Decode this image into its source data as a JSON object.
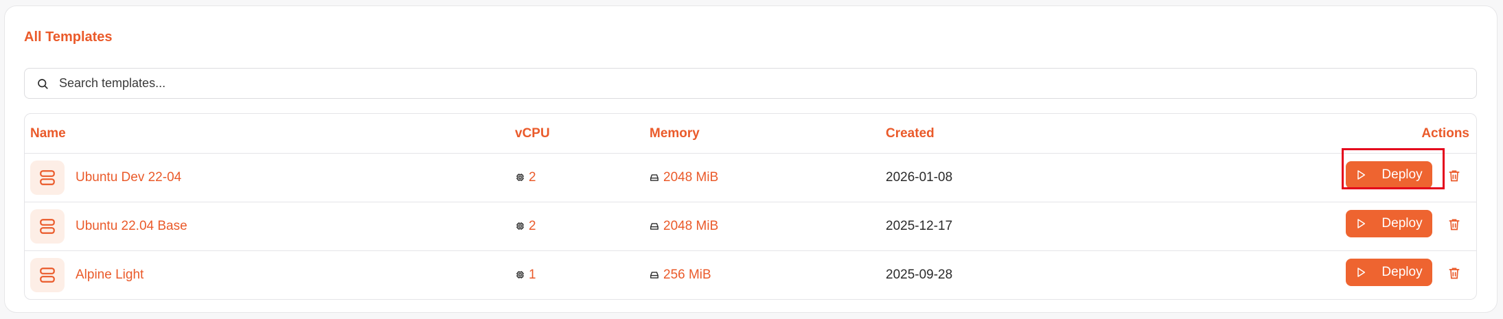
{
  "header": {
    "title": "All Templates"
  },
  "search": {
    "placeholder": "Search templates..."
  },
  "table": {
    "columns": {
      "name": "Name",
      "vcpu": "vCPU",
      "memory": "Memory",
      "created": "Created",
      "actions": "Actions"
    },
    "rows": [
      {
        "name": "Ubuntu Dev 22-04",
        "vcpu": "2",
        "memory": "2048 MiB",
        "created": "2026-01-08",
        "deploy_label": "Deploy"
      },
      {
        "name": "Ubuntu 22.04 Base",
        "vcpu": "2",
        "memory": "2048 MiB",
        "created": "2025-12-17",
        "deploy_label": "Deploy"
      },
      {
        "name": "Alpine Light",
        "vcpu": "1",
        "memory": "256 MiB",
        "created": "2025-09-28",
        "deploy_label": "Deploy"
      }
    ]
  },
  "icons": {
    "search": "search-icon",
    "template": "server-icon",
    "cpu": "cpu-icon",
    "memory": "drive-icon",
    "deploy": "play-icon",
    "delete": "trash-icon"
  },
  "colors": {
    "accent": "#ea5a2a",
    "button": "#ee6430",
    "icon_bg": "#fdeee6",
    "highlight": "#e4001b"
  }
}
